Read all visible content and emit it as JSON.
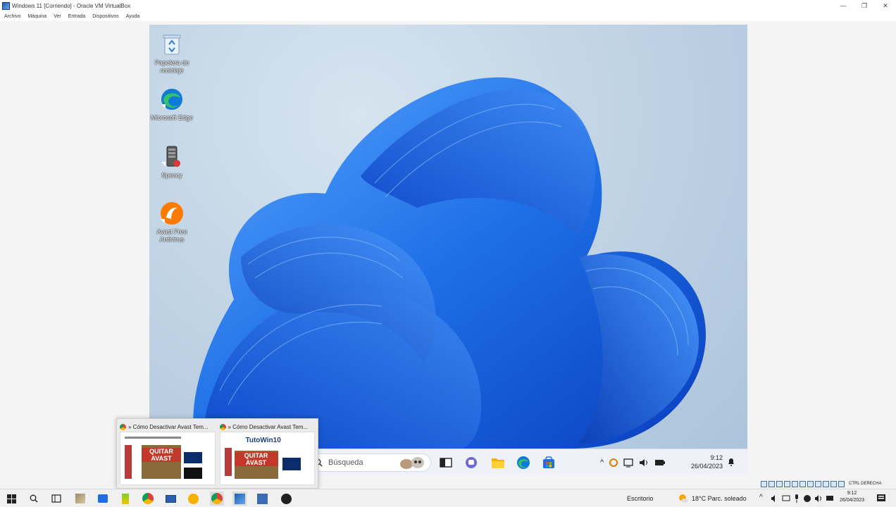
{
  "window": {
    "title": "Windows 11 [Corriendo] - Oracle VM VirtualBox",
    "controls": {
      "minimize": "—",
      "restore": "❐",
      "close": "✕"
    }
  },
  "menu": [
    "Archivo",
    "Máquina",
    "Ver",
    "Entrada",
    "Dispositivos",
    "Ayuda"
  ],
  "desktop_icons": [
    {
      "label": "Papelera de reciclaje",
      "icon": "recycle-bin-icon"
    },
    {
      "label": "Microsoft Edge",
      "icon": "edge-icon"
    },
    {
      "label": "Speccy",
      "icon": "speccy-icon"
    },
    {
      "label": "Avast Free Antivirus",
      "icon": "avast-icon"
    }
  ],
  "guest_taskbar": {
    "search_placeholder": "Búsqueda",
    "time": "9:12",
    "date": "26/04/2023",
    "tray_chevron": "^"
  },
  "thumbnails": [
    {
      "title": "» Cómo Desactivar Avast Tem...",
      "banner": "QUITAR AVAST"
    },
    {
      "title": "» Cómo Desactivar Avast Tem...",
      "banner": "QUITAR AVAST",
      "brand": "TutoWin10"
    }
  ],
  "host_taskbar": {
    "desktop_label": "Escritorio",
    "weather": "18°C  Parc. soleado",
    "time": "9:12",
    "date": "26/04/2023"
  },
  "vb_status": {
    "host_key": "CTRL DERECHA"
  },
  "colors": {
    "accent": "#1e6fe6",
    "bloom_dark": "#0a3fbf",
    "bloom_light": "#3f8df5"
  }
}
